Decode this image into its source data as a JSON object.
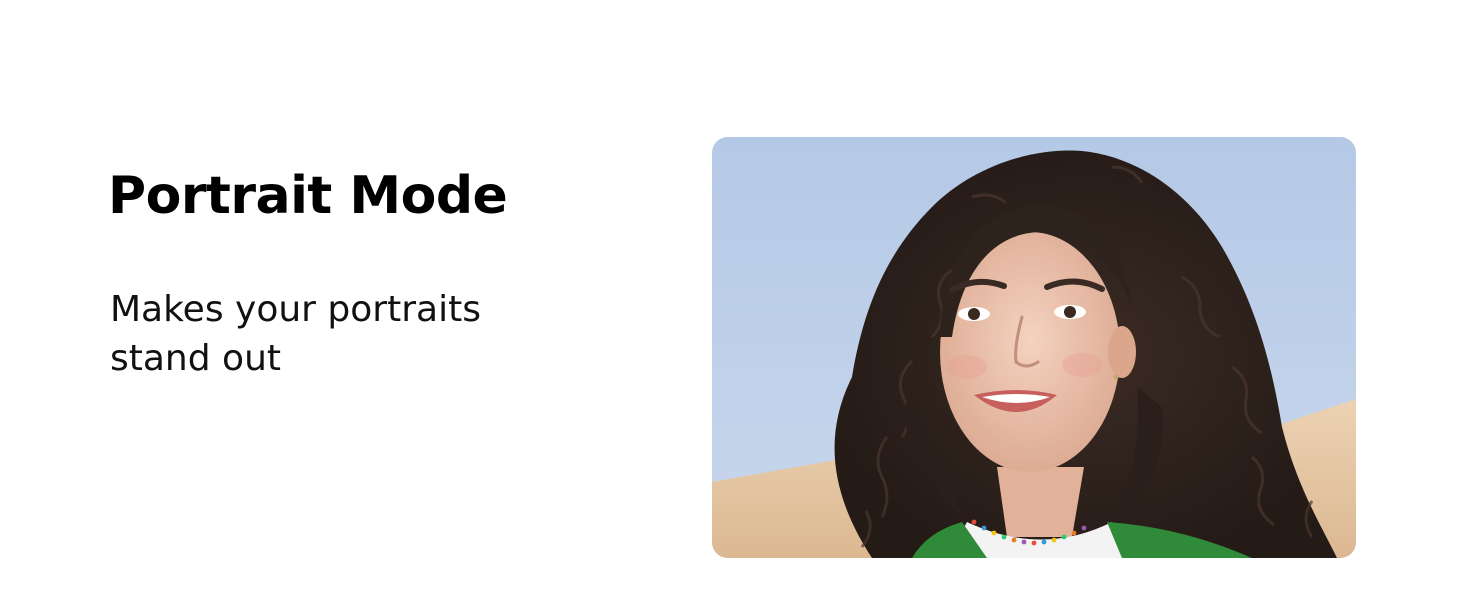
{
  "heading": {
    "title": "Portrait Mode",
    "subtitle": "Makes your portraits stand out"
  },
  "photo": {
    "subject": "smiling-woman-curly-hair",
    "sky_color": "#bcd0ea",
    "wall_color": "#e6c9a6",
    "hair_color": "#2e221d",
    "skin_color": "#e9bea7",
    "jacket_color": "#2f8a3a"
  }
}
